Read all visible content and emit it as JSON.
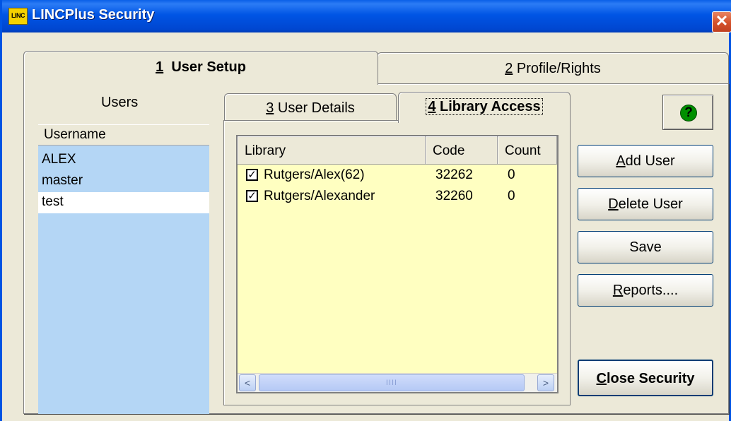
{
  "window": {
    "title": "LINCPlus Security",
    "icon_text": "LINC",
    "close_symbol": "✕"
  },
  "tabs": [
    {
      "hotkey": "1",
      "label": "User Setup",
      "active": true
    },
    {
      "hotkey": "2",
      "label": "Profile/Rights",
      "active": false
    }
  ],
  "users": {
    "heading": "Users",
    "column": "Username",
    "items": [
      "ALEX",
      "master",
      "test"
    ],
    "selected": "test"
  },
  "subtabs": [
    {
      "hotkey": "3",
      "label": "User Details",
      "active": false
    },
    {
      "hotkey": "4",
      "label": "Library Access",
      "active": true
    }
  ],
  "library_grid": {
    "columns": [
      "Library",
      "Code",
      "Count"
    ],
    "rows": [
      {
        "checked": true,
        "library": "Rutgers/Alex(62)",
        "code": "32262",
        "count": "0"
      },
      {
        "checked": true,
        "library": "Rutgers/Alexander",
        "code": "32260",
        "count": "0"
      }
    ],
    "check_glyph": "✓",
    "scroll_left": "<",
    "scroll_right": ">",
    "scroll_grip": "IIII"
  },
  "buttons": {
    "help": "?",
    "add_user": {
      "hotkey": "A",
      "rest": "dd User"
    },
    "delete_user": {
      "hotkey": "D",
      "rest": "elete User"
    },
    "save": "Save",
    "reports": {
      "hotkey": "R",
      "rest": "eports...."
    },
    "close_security": {
      "hotkey": "C",
      "rest": "lose Security"
    }
  },
  "colors": {
    "titlebar": "#0055e5",
    "window_bg": "#ece9d8",
    "users_list_bg": "#b4d6f5",
    "grid_bg": "#ffffc1",
    "help_icon": "#009000"
  }
}
